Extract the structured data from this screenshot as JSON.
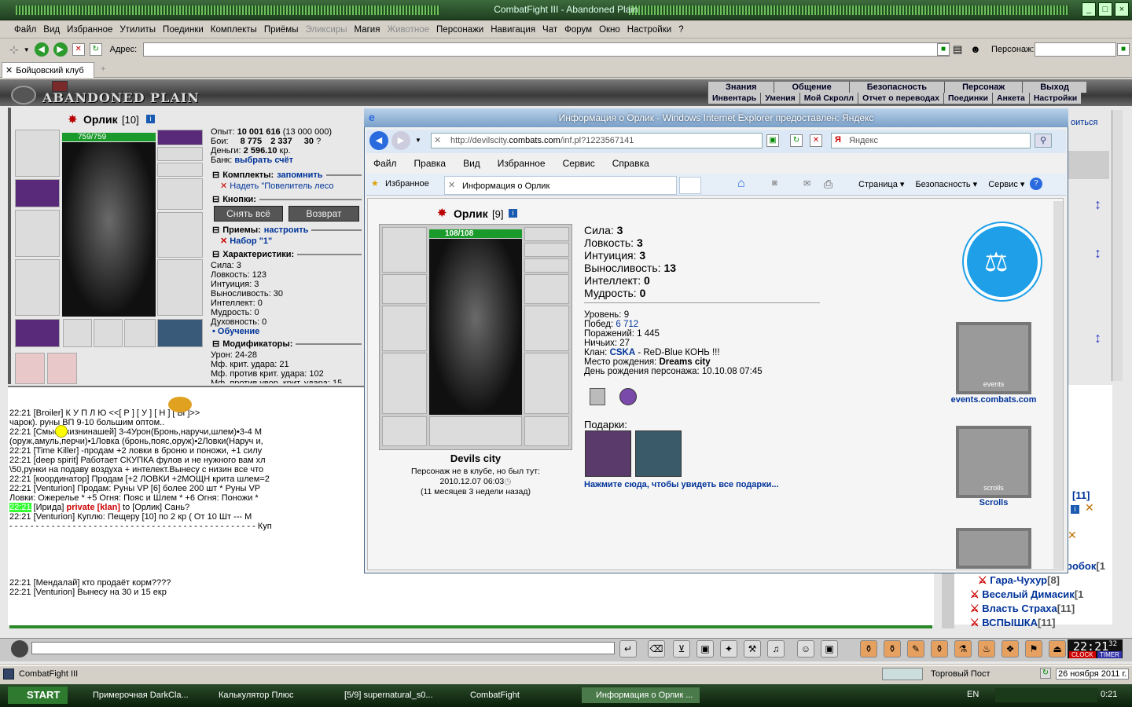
{
  "app": {
    "title": "CombatFight III - Abandoned Plain",
    "menu": [
      "Файл",
      "Вид",
      "Избранное",
      "Утилиты",
      "Поединки",
      "Комплекты",
      "Приёмы",
      "Эликсиры",
      "Магия",
      "Животное",
      "Персонажи",
      "Навигация",
      "Чат",
      "Форум",
      "Окно",
      "Настройки",
      "?"
    ],
    "menu_disabled": [
      "Эликсиры",
      "Животное"
    ],
    "address_label": "Адрес:",
    "persona_label": "Персонаж:",
    "tab": "Бойцовский клуб"
  },
  "game": {
    "logo": "ABANDONED PLAIN",
    "nav_top": [
      "Знания",
      "Общение",
      "Безопасность",
      "Персонаж",
      "Выход"
    ],
    "nav_bottom": [
      "Инвентарь",
      "Умения",
      "Мой Скролл",
      "Отчет о переводах",
      "Поединки",
      "Анкета",
      "Настройки"
    ],
    "char_name": "Орлик",
    "char_level": "[10]",
    "hp": "759/759",
    "exp": "Опыт:",
    "exp_value": "10 001 616",
    "exp_next": "(13 000 000)",
    "fights": "Бои:",
    "fights_value": "8 775",
    "fights_lost": "2 337",
    "fights_draw": "30",
    "money": "Деньги:",
    "money_value": "2 596.10",
    "money_unit": "кр.",
    "bank": "Банк:",
    "bank_link": "выбрать счёт",
    "sections": {
      "sets": "Комплекты:",
      "sets_link": "запомнить",
      "sets_item": "Надеть \"Повелитель лесо",
      "buttons": "Кнопки:",
      "btn_remove": "Снять всё",
      "btn_return": "Возврат",
      "tricks": "Приемы:",
      "tricks_link": "настроить",
      "tricks_item": "Набор \"1\"",
      "chars": "Характеристики:",
      "mods": "Модификаторы:"
    },
    "stats": [
      "Сила: 3",
      "Ловкость: 123",
      "Интуиция: 3",
      "Выносливость: 30",
      "Интеллект: 0",
      "Мудрость: 0",
      "Духовность: 0"
    ],
    "training": "• Обучение",
    "mods": [
      "Урон: 24-28",
      "Мф. крит. удара: 21",
      "Мф. против крит. удара: 102",
      "Мф. против увор. крит. удара: 15"
    ]
  },
  "chat": [
    {
      "t": "22:21",
      "n": "[Broiler]",
      "m": " К У П Л Ю            <<[ Р ] [ У ] [ Н ] [ Ы ]>>"
    },
    {
      "t": "",
      "n": "",
      "m": "чарок).     руны ВП 9-10 большим оптом.."
    },
    {
      "t": "22:21",
      "n": "[Смыслжизнинашей]",
      "m": " 3-4Урон(Бронь,наручи,шлем)•3-4 М"
    },
    {
      "t": "",
      "n": "",
      "m": "(оруж,амуль,перчи)•1Ловка (бронь,пояс,оруж)•2Ловки(Наруч и,"
    },
    {
      "t": "22:21",
      "n": "[Time Killer]",
      "m": " -продам +2 ловки в броню и поножи, +1 силу"
    },
    {
      "t": "22:21",
      "n": "[deep spirit]",
      "m": " Работает СКУПКА фулов и не нужного вам хл"
    },
    {
      "t": "",
      "n": "",
      "m": "\\50,рунки на подаву воздуха + интелект.Вынесу с низин все что"
    },
    {
      "t": "22:21",
      "n": "[координатор]",
      "m": " Продам [+2 ЛОВКИ +2МОЩН крита шлем=2"
    },
    {
      "t": "22:21",
      "n": "[Venturion]",
      "m": " Продам: Руны VP [6] более 200 шт * Руны VP"
    },
    {
      "t": "",
      "n": "",
      "m": "Ловки: Ожерелье * +5 Огня: Пояс и Шлем * +6 Огня: Поножи *"
    },
    {
      "t": "22:21",
      "n": "[Ирида]",
      "m": " to [Орлик] Сань?",
      "priv": "private [klan]"
    },
    {
      "t": "22:21",
      "n": "[Venturion]",
      "m": " Куплю: Пещеру [10] по 2 кр ( От 10 Шт --- М"
    },
    {
      "t": "",
      "n": "",
      "m": "- - - - - - - - - - - - - - - - - - - - - - - - - - - - - - - - - - - - - - - - - - - - - - - Куп"
    },
    {
      "t": "22:21",
      "n": "[Мендалай]",
      "m": " кто продаёт корм????"
    },
    {
      "t": "22:21",
      "n": "[Venturion]",
      "m": " Вынесу на 30 и 15 екр"
    }
  ],
  "right_list": [
    {
      "name": "Гара-Чухур",
      "lvl": "[8]"
    },
    {
      "name": "Веселый Димасик",
      "lvl": "[1"
    },
    {
      "name": "Власть Страха",
      "lvl": "[11]"
    },
    {
      "name": "ВСПЫШКА",
      "lvl": "[11]"
    }
  ],
  "right_fragments": {
    "lvl11": "[11]",
    "korobok": "робок",
    "lvl_tail": "[1"
  },
  "left_top_fragment": "оиться",
  "ie": {
    "title": "Информация о Орлик - Windows Internet Explorer предоставлен: Яндекс",
    "url": "http://devilscity.combats.com/inf.pl?1223567141",
    "url_domain": "combats.com",
    "search": "Яндекс",
    "menu": [
      "Файл",
      "Правка",
      "Вид",
      "Избранное",
      "Сервис",
      "Справка"
    ],
    "fav": "Избранное",
    "tab": "Информация о Орлик",
    "tools": [
      "Страница",
      "Безопасность",
      "Сервис"
    ],
    "char_name": "Орлик",
    "char_level": "[9]",
    "hp": "108/108",
    "city": "Devils city",
    "notin": "Персонаж не в клубе, но был тут:",
    "lastseen": "2010.12.07 06:03",
    "ago": "(11 месяцев 3 недели назад)",
    "stats": [
      {
        "k": "Сила:",
        "v": "3"
      },
      {
        "k": "Ловкость:",
        "v": "3"
      },
      {
        "k": "Интуиция:",
        "v": "3"
      },
      {
        "k": "Выносливость:",
        "v": "13"
      },
      {
        "k": "Интеллект:",
        "v": "0"
      },
      {
        "k": "Мудрость:",
        "v": "0"
      }
    ],
    "level": "Уровень: 9",
    "wins_label": "Побед:",
    "wins": "6 712",
    "losses": "Поражений: 1 445",
    "draws": "Ничьих: 27",
    "clan_label": "Клан:",
    "clan": "CSKA",
    "clan_desc": " - ReD-Blue КОНЬ !!!",
    "birth_label": "Место рождения:",
    "birth": "Dreams city",
    "bday": "День рождения персонажа: 10.10.08 07:45",
    "gifts": "Подарки:",
    "gifts_link": "Нажмите сюда, чтобы увидеть все подарки...",
    "events": "events.combats.com",
    "events_banner": "events",
    "scrolls": "Scrolls",
    "scrolls_banner": "scrolls"
  },
  "statusbar": {
    "left": "CombatFight III",
    "right": "Торговый Пост",
    "date": "26 ноября 2011 г."
  },
  "clock": {
    "time": "22:21",
    "sec": "32",
    "clock": "CLOCK",
    "timer": "TIMER"
  },
  "taskbar": {
    "start": "START",
    "items": [
      "Примерочная DarkCla...",
      "Калькулятор Плюс",
      "[5/9] supernatural_s0...",
      "CombatFight",
      "Информация о Орлик ..."
    ],
    "lang": "EN",
    "time": "0:21"
  }
}
